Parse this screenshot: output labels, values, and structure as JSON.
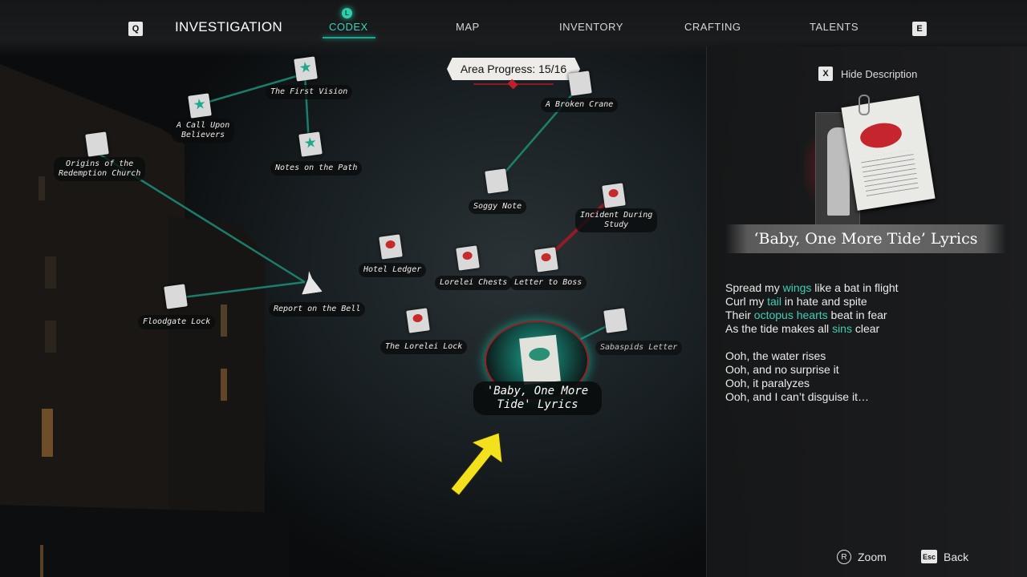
{
  "topnav": {
    "left_key": "Q",
    "right_key": "E",
    "codex_key": "L",
    "tabs": [
      {
        "label": "INVESTIGATION",
        "active": true
      },
      {
        "label": "CODEX",
        "active": false
      },
      {
        "label": "MAP",
        "active": false
      },
      {
        "label": "INVENTORY",
        "active": false
      },
      {
        "label": "CRAFTING",
        "active": false
      },
      {
        "label": "TALENTS",
        "active": false
      }
    ]
  },
  "area_progress": "Area Progress:  15/16",
  "nodes": [
    {
      "label": "The First Vision",
      "icon": "green-star-document-icon"
    },
    {
      "label": "A Call Upon\nBelievers",
      "icon": "green-star-document-icon"
    },
    {
      "label": "Origins of the\nRedemption Church",
      "icon": "green-document-icon"
    },
    {
      "label": "Notes on the Path",
      "icon": "green-star-document-icon"
    },
    {
      "label": "A Broken Crane",
      "icon": "crane-icon"
    },
    {
      "label": "Soggy Note",
      "icon": "green-document-icon"
    },
    {
      "label": "Incident During\nStudy",
      "icon": "red-document-icon"
    },
    {
      "label": "Hotel Ledger",
      "icon": "red-document-icon"
    },
    {
      "label": "Lorelei Chests",
      "icon": "red-document-icon"
    },
    {
      "label": "Letter to Boss",
      "icon": "red-document-icon"
    },
    {
      "label": "Floodgate Lock",
      "icon": "green-document-icon"
    },
    {
      "label": "Report on the Bell",
      "icon": "bell-icon"
    },
    {
      "label": "The Lorelei Lock",
      "icon": "red-document-icon"
    },
    {
      "label": "Sabaspids Letter",
      "icon": "green-document-icon"
    }
  ],
  "selected_node": {
    "label": "'Baby, One More\nTide' Lyrics",
    "icon": "green-document-icon"
  },
  "colors": {
    "accent": "#3fcfb4",
    "selection_ring": "#9a1e26",
    "arrow": "#f2e11c"
  },
  "panel": {
    "hide_key": "X",
    "hide_label": "Hide Description",
    "title": "‘Baby, One More Tide’ Lyrics",
    "lyrics": [
      [
        {
          "t": "Spread my "
        },
        {
          "t": "wings",
          "hl": true
        },
        {
          "t": " like a bat in flight"
        }
      ],
      [
        {
          "t": "Curl my "
        },
        {
          "t": "tail",
          "hl": true
        },
        {
          "t": " in hate and spite"
        }
      ],
      [
        {
          "t": "Their "
        },
        {
          "t": "octopus hearts",
          "hl": true
        },
        {
          "t": " beat in fear"
        }
      ],
      [
        {
          "t": "As the tide makes all "
        },
        {
          "t": "sins",
          "hl": true
        },
        {
          "t": " clear"
        }
      ],
      [],
      [
        {
          "t": "Ooh, the water rises"
        }
      ],
      [
        {
          "t": "Ooh, and no surprise it"
        }
      ],
      [
        {
          "t": "Ooh, it paralyzes"
        }
      ],
      [
        {
          "t": "Ooh, and I can’t disguise it…"
        }
      ]
    ]
  },
  "footer": {
    "zoom_label": "Zoom",
    "zoom_icon": "right-stick-icon",
    "back_key": "Esc",
    "back_label": "Back"
  }
}
